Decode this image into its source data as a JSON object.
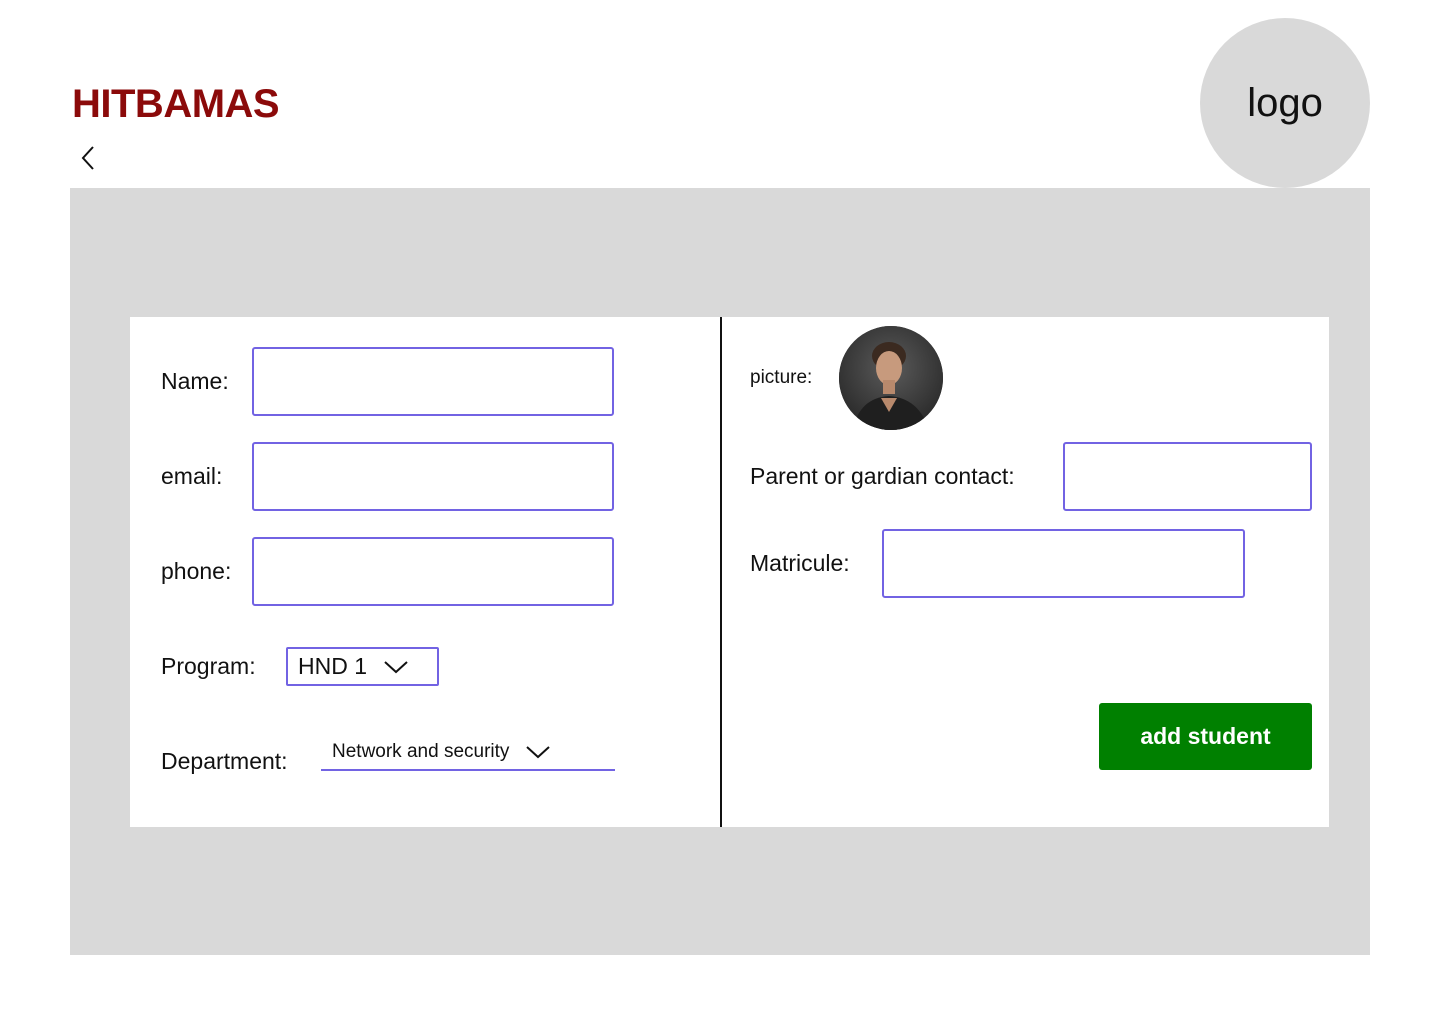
{
  "header": {
    "brand": "HITBAMAS",
    "logo_text": "logo",
    "back_icon": "chevron-left-icon"
  },
  "form": {
    "name_label": "Name:",
    "name_value": "",
    "email_label": "email:",
    "email_value": "",
    "phone_label": "phone:",
    "phone_value": "",
    "program_label": "Program:",
    "program_value": "HND 1",
    "department_label": "Department:",
    "department_value": "Network and security",
    "picture_label": "picture:",
    "parent_label": "Parent or gardian contact:",
    "parent_value": "",
    "matricule_label": "Matricule:",
    "matricule_value": "",
    "submit_label": "add student"
  },
  "colors": {
    "brand": "#8b0a0a",
    "field_border": "#7263e3",
    "panel_bg": "#d9d9d9",
    "submit_bg": "#008000"
  }
}
